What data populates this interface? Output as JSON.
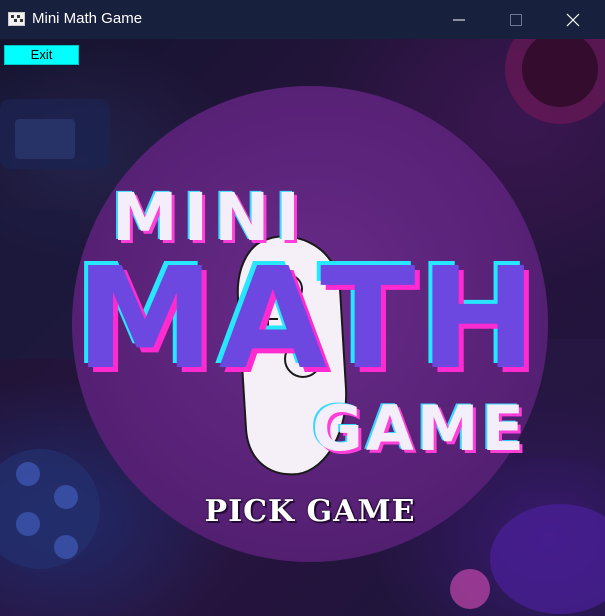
{
  "window": {
    "title": "Mini Math Game",
    "controls": {
      "minimize": "minimize",
      "maximize": "maximize",
      "close": "close"
    }
  },
  "toolbar": {
    "exit_label": "Exit"
  },
  "logo": {
    "line1": "MINI",
    "line2": "MATH",
    "line3": "GAME"
  },
  "menu": {
    "pick_game_label": "PICK GAME"
  },
  "colors": {
    "titlebar": "#17203d",
    "exit_button": "#00ffff",
    "circle": "#5a2279",
    "math_text": "#6c48e0",
    "accent_pink": "#ff2ad0",
    "accent_cyan": "#27e6ff"
  },
  "icons": [
    "app-icon",
    "minimize-icon",
    "maximize-icon",
    "close-icon",
    "game-controller-icon"
  ]
}
